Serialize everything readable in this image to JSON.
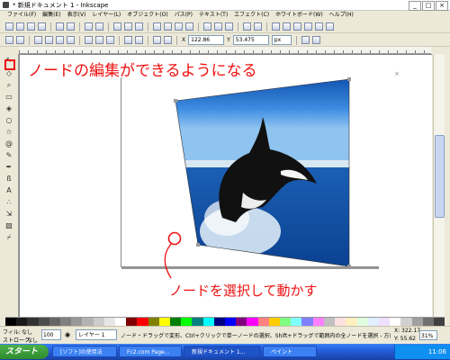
{
  "window": {
    "title": "* 新規ドキュメント 1 - Inkscape",
    "min": "_",
    "max": "□",
    "close": "×"
  },
  "menu": [
    "ファイル(F)",
    "編集(E)",
    "表示(V)",
    "レイヤー(L)",
    "オブジェクト(O)",
    "パス(P)",
    "テキスト(T)",
    "エフェクト(C)",
    "ホワイトボード(W)",
    "ヘルプ(H)"
  ],
  "toolbar3": {
    "x_label": "X",
    "x_value": "122.86",
    "y_label": "Y",
    "y_value": "53.475",
    "unit": "px"
  },
  "annotations": {
    "top": "ノードの編集ができるようになる",
    "bottom": "ノードを選択して動かす"
  },
  "palette_colors": [
    "#000000",
    "#1a1a1a",
    "#333333",
    "#4d4d4d",
    "#666666",
    "#808080",
    "#999999",
    "#b3b3b3",
    "#cccccc",
    "#e6e6e6",
    "#ffffff",
    "#800000",
    "#ff0000",
    "#808000",
    "#ffff00",
    "#008000",
    "#00ff00",
    "#008080",
    "#00ffff",
    "#000080",
    "#0000ff",
    "#800080",
    "#ff00ff",
    "#ff8080",
    "#ffcc00",
    "#80ff80",
    "#80ffff",
    "#8080ff",
    "#ff80ff",
    "#c0c0c0",
    "#ffe0e0",
    "#fff0c0",
    "#e0ffe0",
    "#e0f0ff",
    "#f0e0ff",
    "#ffffff",
    "#d0d0d0",
    "#a0a0a0",
    "#707070",
    "#404040"
  ],
  "status": {
    "fill_label": "フィル:",
    "stroke_label": "ストローク:",
    "none1": "なし",
    "none2": "なし",
    "opacity": "100",
    "layer": "レイヤー 1",
    "message": "ノード・ドラッグで変形、Ctrl+クリックで単一ノードの選択、Shift+ドラッグで範囲内の全ノードを選択 - 方向キーで移動",
    "coords_x": "X: 322.17",
    "coords_y": "Y: 55.62",
    "zoom": "31%"
  },
  "taskbar": {
    "start": "スタート",
    "tasks": [
      "[ソフト]の使用法",
      "Fc2.com Page...",
      "新規ドキュメント 1...",
      "ペイント"
    ],
    "clock": "11:06"
  }
}
